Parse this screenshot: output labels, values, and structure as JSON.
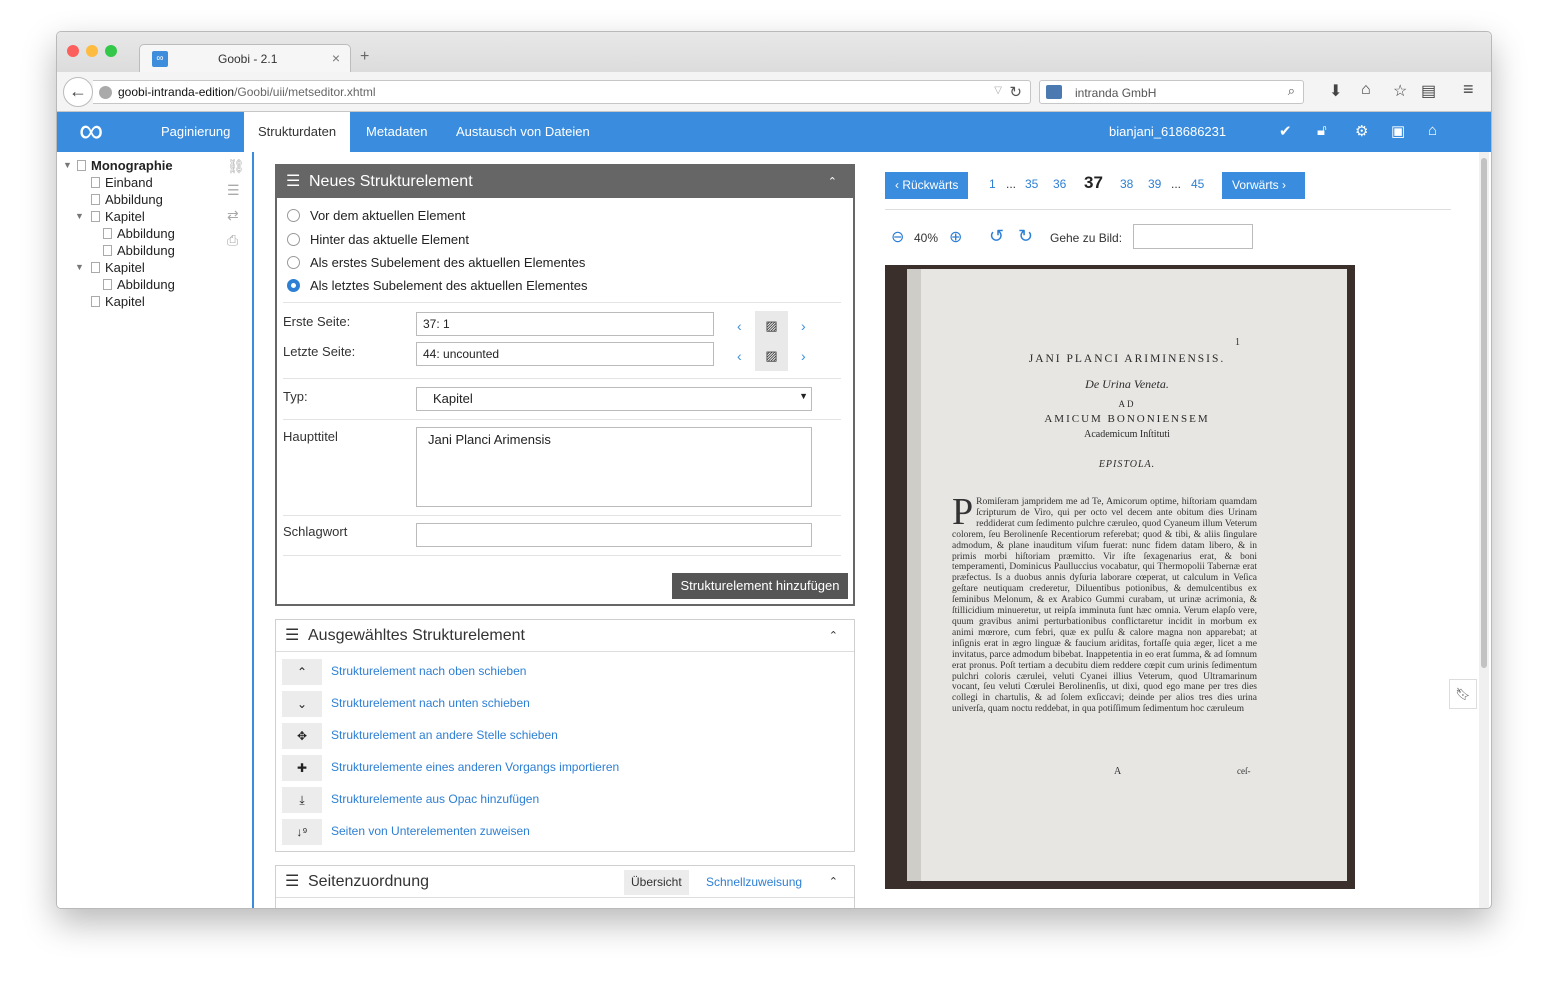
{
  "browser": {
    "tab_title": "Goobi - 2.1",
    "tab_favicon": "∞",
    "new_tab": "+",
    "url_host": "goobi-intranda-edition",
    "url_path": "/Goobi/uii/metseditor.xhtml",
    "search_engine": "intranda GmbH"
  },
  "app": {
    "logo": "∞",
    "nav": [
      "Paginierung",
      "Strukturdaten",
      "Metadaten",
      "Austausch von Dateien"
    ],
    "active_nav": "Strukturdaten",
    "user": "bianjani_618686231",
    "accent_color": "#3a8dde"
  },
  "tree": {
    "items": [
      {
        "label": "Monographie",
        "bold": true
      },
      {
        "label": "Einband"
      },
      {
        "label": "Abbildung"
      },
      {
        "label": "Kapitel"
      },
      {
        "label": "Abbildung"
      },
      {
        "label": "Abbildung"
      },
      {
        "label": "Kapitel"
      },
      {
        "label": "Abbildung"
      },
      {
        "label": "Kapitel"
      }
    ]
  },
  "new_element": {
    "title": "Neues Strukturelement",
    "options": [
      "Vor dem aktuellen Element",
      "Hinter das aktuelle Element",
      "Als erstes Subelement des aktuellen Elementes",
      "Als letztes Subelement des aktuellen Elementes"
    ],
    "selected_option": 3,
    "first_page_label": "Erste Seite:",
    "first_page_value": "37: 1",
    "last_page_label": "Letzte Seite:",
    "last_page_value": "44: uncounted",
    "type_label": "Typ:",
    "type_value": "Kapitel",
    "maintitle_label": "Haupttitel",
    "maintitle_value": "Jani Planci Arimensis",
    "keyword_label": "Schlagwort",
    "keyword_value": "",
    "add_button": "Strukturelement hinzufügen"
  },
  "selected_element": {
    "title": "Ausgewähltes Strukturelement",
    "actions": [
      {
        "icon": "chevron-up-icon",
        "glyph": "⌃",
        "label": "Strukturelement nach oben schieben"
      },
      {
        "icon": "chevron-down-icon",
        "glyph": "⌄",
        "label": "Strukturelement nach unten schieben"
      },
      {
        "icon": "move-icon",
        "glyph": "✥",
        "label": "Strukturelement an andere Stelle schieben"
      },
      {
        "icon": "puzzle-icon",
        "glyph": "✚",
        "label": "Strukturelemente eines anderen Vorgangs importieren"
      },
      {
        "icon": "download-icon",
        "glyph": "⤓",
        "label": "Strukturelemente aus Opac hinzufügen"
      },
      {
        "icon": "sort-numeric-icon",
        "glyph": "↓⁹",
        "label": "Seiten von Unterelementen zuweisen"
      }
    ]
  },
  "page_assignment": {
    "title": "Seitenzuordnung",
    "tab_overview": "Übersicht",
    "tab_quick": "Schnellzuweisung"
  },
  "viewer": {
    "prev": "Rückwärts",
    "next": "Vorwärts",
    "pages": [
      "1",
      "...",
      "35",
      "36",
      "37",
      "38",
      "39",
      "...",
      "45"
    ],
    "current_page": "37",
    "zoom": "40%",
    "goto_label": "Gehe zu Bild:",
    "goto_value": "",
    "scan": {
      "page_number": "1",
      "heading1": "JANI PLANCI ARIMINENSIS.",
      "heading2": "De Urina Veneta.",
      "heading3": "AD",
      "heading4": "AMICUM BONONIENSEM",
      "heading5": "Academicum Inſtituti",
      "heading6": "EPISTOLA.",
      "initial": "P",
      "body": "Romiſeram jampridem me ad Te, Amicorum optime, hiſtoriam quamdam ſcripturum de Viro, qui per octo vel decem ante obitum dies Urinam reddiderat cum ſedimento pulchre cæruleo, quod Cyaneum illum Veterum colorem, ſeu Berolinenſe Recentiorum referebat; quod & tibi, & aliis ſingulare admodum, & plane inauditum viſum fuerat: nunc fidem datam libero, & in primis morbi hiſtoriam præmitto. Vir iſte ſexagenarius erat, & boni temperamenti, Dominicus Paulluccius vocabatur, qui Thermopolii Tabernæ erat præfectus. Is a duobus annis dyſuria laborare cœperat, ut calculum in Veſica geſtare neutiquam crederetur, Diluentibus potionibus, & demulcentibus ex ſeminibus Melonum, & ex Arabico Gummi curabam, ut urinæ acrimonia, & ſtillicidium minueretur, ut reipſa imminuta ſunt hæc omnia. Verum elapſo vere, quum gravibus animi perturbationibus conflictaretur incidit in morbum ex animi mœrore, cum febri, quæ ex pulſu & calore magna non apparebat; at inſignis erat in ægro linguæ & faucium ariditas, fortaſſe quia æger, licet a me invitatus, parce admodum bibebat. Inappetentia in eo erat ſumma, & ad ſomnum erat pronus. Poſt tertiam a decubitu diem reddere cœpit cum urinis ſedimentum pulchri coloris cærulei, veluti Cyanei illius Veterum, quod Ultramarinum vocant, ſeu veluti Cœrulei Berolinenſis, ut dixi, quod ego mane per tres dies collegi in chartulis, & ad ſolem exſiccavi; deinde per alios tres dies urina univerſa, quam noctu reddebat, in qua potiſſimum ſedimentum hoc cæruleum",
      "signature": "A",
      "catchword": "ceſ-"
    }
  }
}
